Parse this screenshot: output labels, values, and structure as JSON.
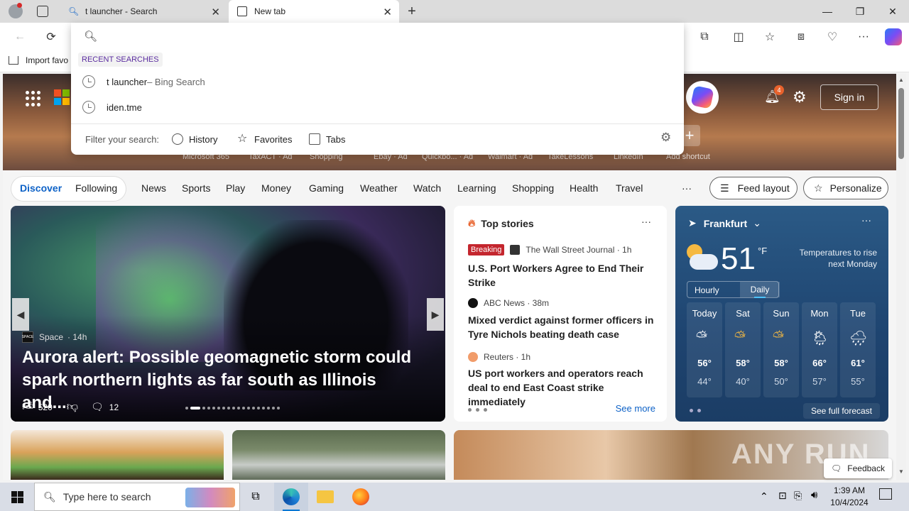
{
  "tabs": [
    {
      "title": "t launcher - Search"
    },
    {
      "title": "New tab"
    }
  ],
  "favorites_bar": {
    "import_label": "Import favo"
  },
  "dropdown": {
    "recent_label": "RECENT SEARCHES",
    "suggestions": [
      {
        "text": "t launcher",
        "suffix": " – Bing Search"
      },
      {
        "text": "iden.tme",
        "suffix": ""
      }
    ],
    "filter_label": "Filter your search:",
    "filters": [
      "History",
      "Favorites",
      "Tabs"
    ]
  },
  "hero": {
    "notifications_count": "4",
    "sign_in": "Sign in",
    "shortcuts": [
      "Microsoft 365",
      "TaxACT · Ad",
      "Shopping",
      "Ebay · Ad",
      "Quickbo... · Ad",
      "Walmart · Ad",
      "TakeLessons",
      "LinkedIn",
      "Add shortcut"
    ]
  },
  "nav": {
    "discover": "Discover",
    "following": "Following",
    "items": [
      "News",
      "Sports",
      "Play",
      "Money",
      "Gaming",
      "Weather",
      "Watch",
      "Learning",
      "Shopping",
      "Health",
      "Travel"
    ],
    "more": "···",
    "feed_layout": "Feed layout",
    "personalize": "Personalize"
  },
  "main_story": {
    "source": "Space",
    "age": "· 14h",
    "headline": "Aurora alert: Possible geomagnetic storm could spark northern lights as far south as Illinois and...",
    "likes": "520",
    "comments": "12"
  },
  "top_stories": {
    "title": "Top stories",
    "more": "···",
    "stories": [
      {
        "badge": "Breaking",
        "source": "The Wall Street Journal · 1h",
        "title": "U.S. Port Workers Agree to End Their Strike"
      },
      {
        "badge": "",
        "source": "ABC News · 38m",
        "title": "Mixed verdict against former officers in Tyre Nichols beating death case"
      },
      {
        "badge": "",
        "source": "Reuters · 1h",
        "title": "US port workers and operators reach deal to end East Coast strike immediately"
      }
    ],
    "see_more": "See more"
  },
  "weather": {
    "location": "Frankfurt",
    "temp": "51",
    "unit": "°F",
    "note": "Temperatures to rise next Monday",
    "tab_hourly": "Hourly",
    "tab_daily": "Daily",
    "days": [
      {
        "name": "Today",
        "hi": "56°",
        "lo": "44°",
        "icon": "partly-cloudy-icon"
      },
      {
        "name": "Sat",
        "hi": "58°",
        "lo": "40°",
        "icon": "partly-sunny-icon"
      },
      {
        "name": "Sun",
        "hi": "58°",
        "lo": "50°",
        "icon": "partly-sunny-icon"
      },
      {
        "name": "Mon",
        "hi": "66°",
        "lo": "57°",
        "icon": "rain-sun-icon"
      },
      {
        "name": "Tue",
        "hi": "61°",
        "lo": "55°",
        "icon": "rain-icon"
      }
    ],
    "forecast_link": "See full forecast"
  },
  "watermark": "ANY RUN",
  "feedback": "Feedback",
  "taskbar": {
    "search_placeholder": "Type here to search",
    "time": "1:39 AM",
    "date": "10/4/2024"
  },
  "colors": {
    "accent": "#0e62c7",
    "breaking": "#c4262e",
    "weather_bg": "#1e4470"
  }
}
